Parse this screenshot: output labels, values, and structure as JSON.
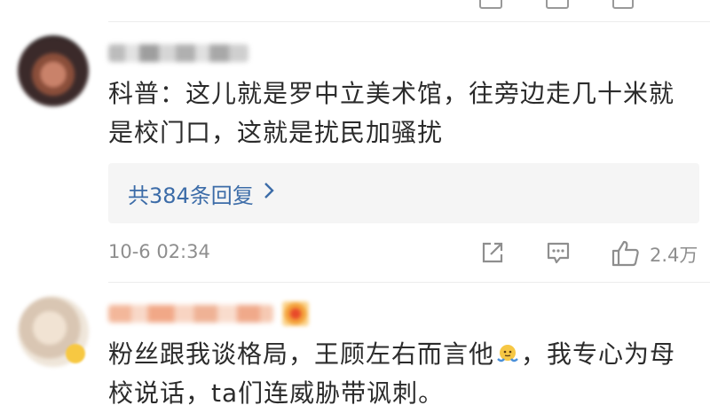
{
  "comment1": {
    "text": "科普：这儿就是罗中立美术馆，往旁边走几十米就是校门口，这就是扰民加骚扰",
    "replies_label": "共384条回复",
    "time": "10-6 02:34",
    "likes": "2.4万"
  },
  "comment2": {
    "text_part1": "粉丝跟我谈格局，王顾左右而言他",
    "text_part2": "，我专心为母校说话，ta们连威胁带讽刺。"
  },
  "icons": {
    "share": "share-icon",
    "comment": "comment-icon",
    "like": "thumbs-up-icon",
    "chevron": "chevron-right-icon",
    "emoji": "shrug-emoji-icon"
  },
  "colors": {
    "link": "#3c6ca8",
    "meta": "#8e8e8e",
    "reply_bg": "#f5f5f5"
  }
}
